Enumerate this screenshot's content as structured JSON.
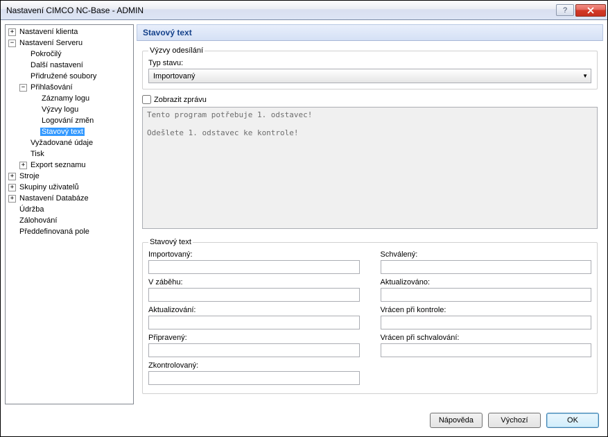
{
  "window": {
    "title": "Nastavení CIMCO NC-Base - ADMIN"
  },
  "tree": {
    "n0": "Nastavení klienta",
    "n1": "Nastavení Serveru",
    "n1_0": "Pokročilý",
    "n1_1": "Další nastavení",
    "n1_2": "Přidružené soubory",
    "n1_3": "Přihlašování",
    "n1_3_0": "Záznamy logu",
    "n1_3_1": "Výzvy logu",
    "n1_3_2": "Logování změn",
    "n1_3_3": "Stavový text",
    "n1_4": "Vyžadované údaje",
    "n1_5": "Tisk",
    "n1_6": "Export seznamu",
    "n2": "Stroje",
    "n3": "Skupiny uživatelů",
    "n4": "Nastavení Databáze",
    "n5": "Údržba",
    "n6": "Zálohování",
    "n7": "Předdefinovaná pole"
  },
  "main": {
    "heading": "Stavový text",
    "group1_legend": "Výzvy odesílání",
    "type_label": "Typ stavu:",
    "type_value": "Importovaný",
    "show_msg_label": "Zobrazit zprávu",
    "textarea_value": "Tento program potřebuje 1. odstavec!\n\nOdešlete 1. odstavec ke kontrole!",
    "group2_legend": "Stavový text",
    "fields": {
      "imported": "Importovaný:",
      "approved": "Schválený:",
      "running": "V záběhu:",
      "updated": "Aktualizováno:",
      "updating": "Aktualizování:",
      "returned_check": "Vrácen při kontrole:",
      "ready": "Připravený:",
      "returned_approve": "Vrácen při schvalování:",
      "checked": "Zkontrolovaný:"
    }
  },
  "buttons": {
    "help": "Nápověda",
    "default": "Výchozí",
    "ok": "OK"
  }
}
